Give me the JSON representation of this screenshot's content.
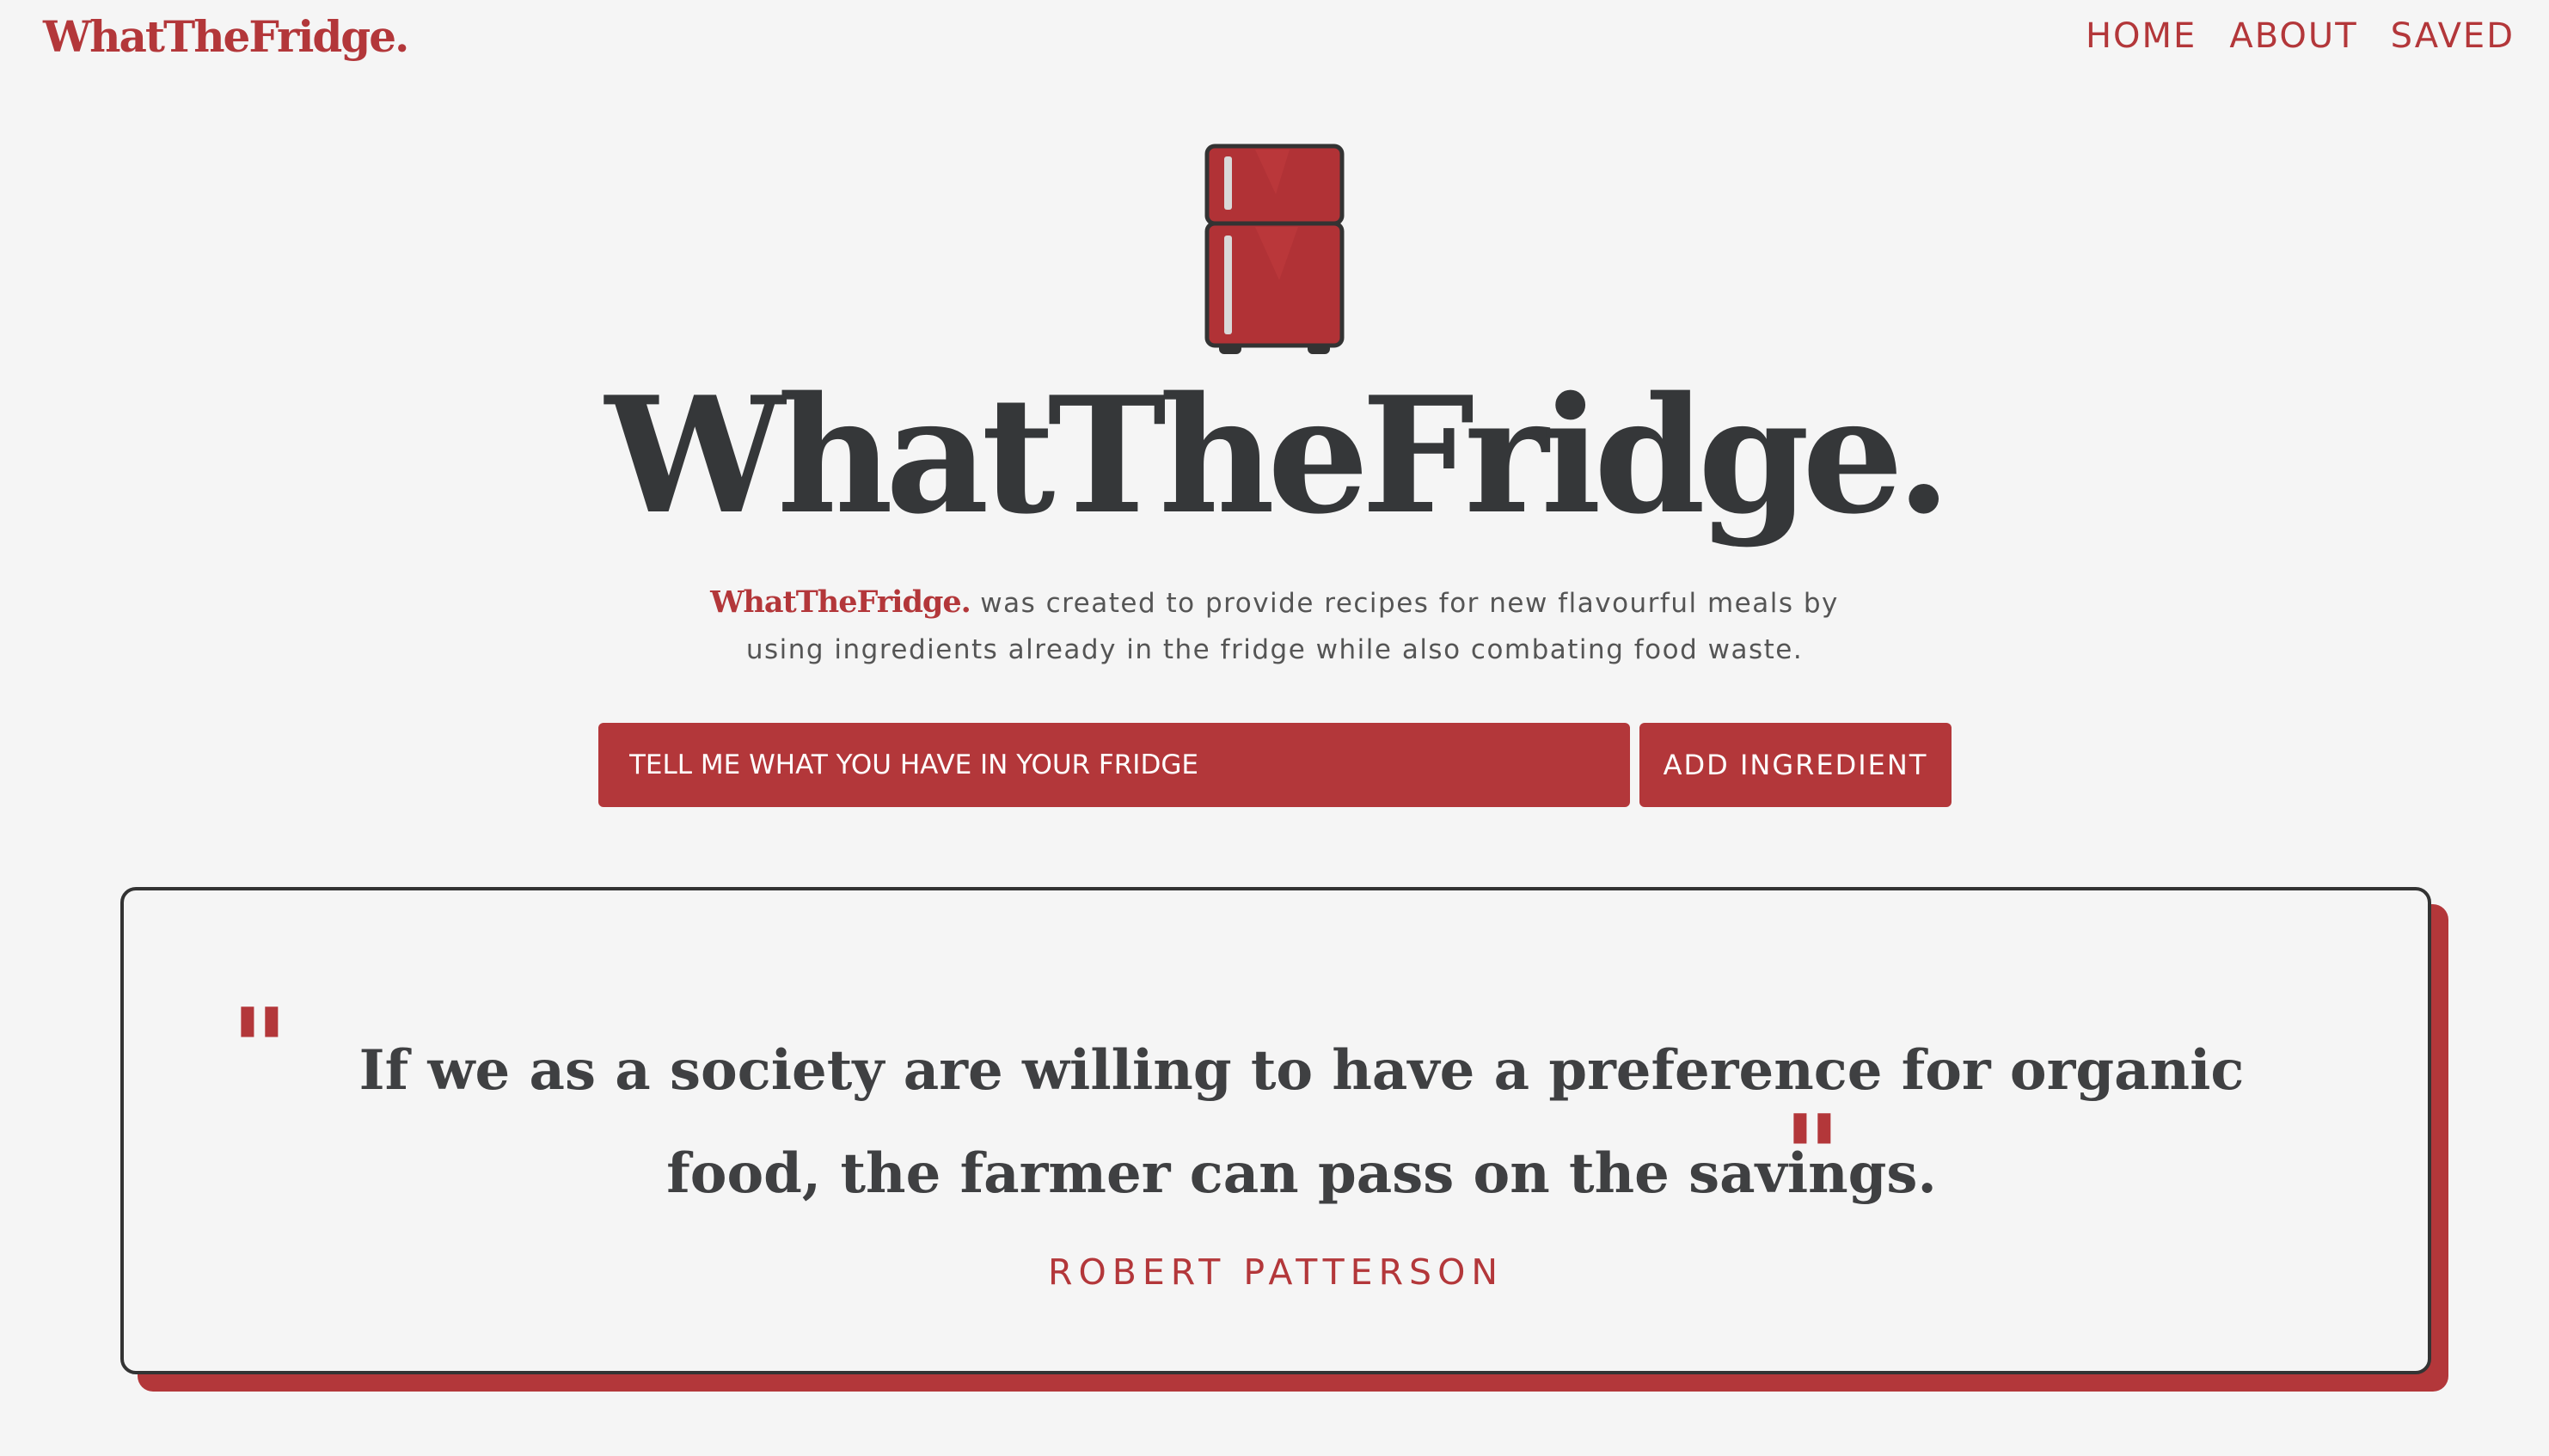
{
  "header": {
    "brand": "WhatTheFridge.",
    "nav": {
      "home": "HOME",
      "about": "ABOUT",
      "saved": "SAVED"
    }
  },
  "hero": {
    "title": "WhatTheFridge.",
    "tagline_brand": "WhatTheFridge.",
    "tagline_text": " was created to provide recipes for new flavourful meals by using ingredients already in the fridge while also combating food waste."
  },
  "search": {
    "placeholder": "TELL ME WHAT YOU HAVE IN YOUR FRIDGE",
    "button_label": "ADD INGREDIENT"
  },
  "quote": {
    "open_mark": "\"",
    "close_mark": "\"",
    "text": "If we as a society are willing to have a preference for organic food, the farmer can pass on the savings.",
    "author": "ROBERT PATTERSON"
  },
  "colors": {
    "accent": "#b3373a",
    "background": "#f5f5f5",
    "text_dark": "#353739"
  },
  "icons": {
    "hero_icon": "fridge-icon"
  }
}
